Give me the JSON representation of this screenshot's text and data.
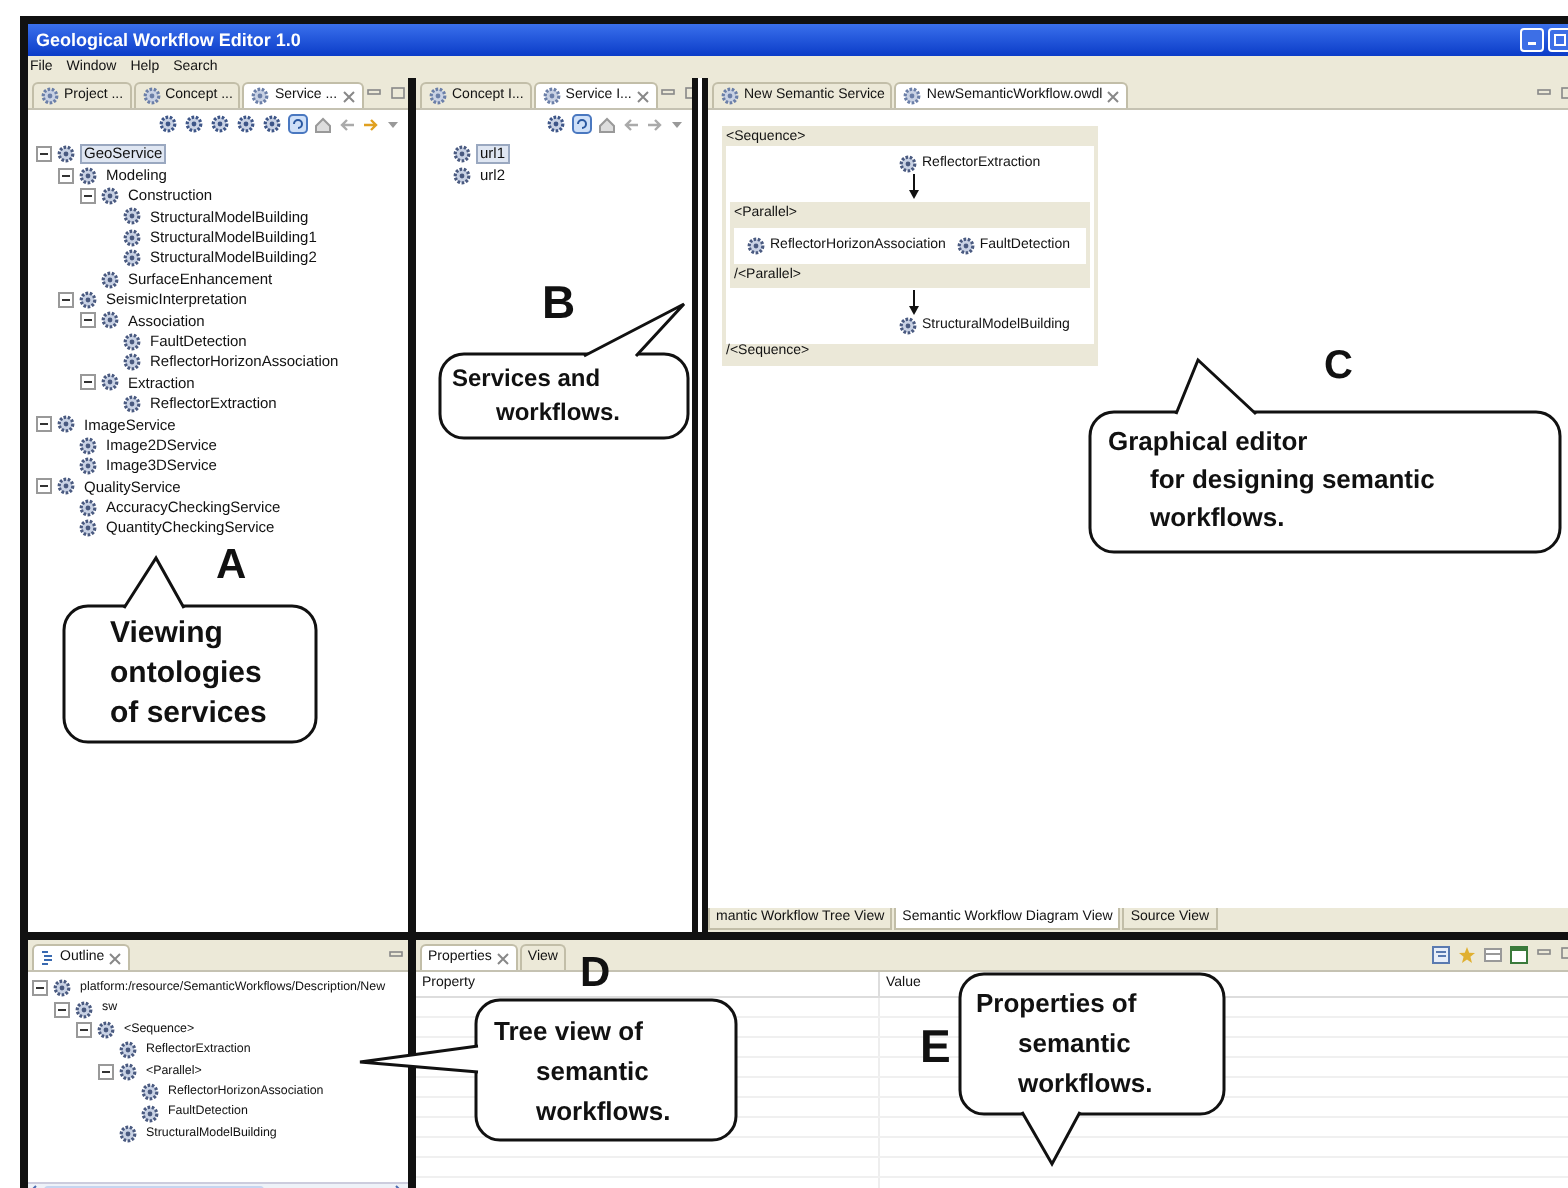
{
  "window": {
    "title": "Geological Workflow Editor 1.0"
  },
  "menu": [
    "File",
    "Window",
    "Help",
    "Search"
  ],
  "service_panel": {
    "tabs": [
      {
        "label": "Project ...",
        "selected": false
      },
      {
        "label": "Concept ...",
        "selected": false
      },
      {
        "label": "Service ...",
        "selected": true
      }
    ],
    "tree": [
      {
        "label": "GeoService",
        "selected": true,
        "expanded": true,
        "children": [
          {
            "label": "Modeling",
            "selected": false,
            "expanded": true,
            "children": [
              {
                "label": "Construction",
                "selected": false,
                "expanded": true,
                "children": [
                  {
                    "label": "StructuralModelBuilding",
                    "selected": false
                  },
                  {
                    "label": "StructuralModelBuilding1",
                    "selected": false
                  },
                  {
                    "label": "StructuralModelBuilding2",
                    "selected": false
                  }
                ]
              },
              {
                "label": "SurfaceEnhancement",
                "selected": false
              }
            ]
          },
          {
            "label": "SeismicInterpretation",
            "selected": false,
            "expanded": true,
            "children": [
              {
                "label": "Association",
                "selected": false,
                "expanded": true,
                "children": [
                  {
                    "label": "FaultDetection",
                    "selected": false
                  },
                  {
                    "label": "ReflectorHorizonAssociation",
                    "selected": false
                  }
                ]
              },
              {
                "label": "Extraction",
                "selected": false,
                "expanded": true,
                "children": [
                  {
                    "label": "ReflectorExtraction",
                    "selected": false
                  }
                ]
              }
            ]
          }
        ]
      },
      {
        "label": "ImageService",
        "selected": false,
        "expanded": true,
        "children": [
          {
            "label": "Image2DService",
            "selected": false
          },
          {
            "label": "Image3DService",
            "selected": false
          }
        ]
      },
      {
        "label": "QualityService",
        "selected": false,
        "expanded": true,
        "children": [
          {
            "label": "AccuracyCheckingService",
            "selected": false
          },
          {
            "label": "QuantityCheckingService",
            "selected": false
          }
        ]
      }
    ]
  },
  "services_panel": {
    "tabs": [
      {
        "label": "Concept I...",
        "selected": false
      },
      {
        "label": "Service I...",
        "selected": true
      }
    ],
    "tree": [
      {
        "label": "url1",
        "selected": true
      },
      {
        "label": "url2",
        "selected": false
      }
    ]
  },
  "editor": {
    "tabs": [
      {
        "label": "New Semantic Service",
        "selected": false
      },
      {
        "label": "NewSemanticWorkflow.owdl",
        "selected": true
      }
    ],
    "diagram": {
      "open": "<Sequence>",
      "close": "/<Sequence>",
      "steps": [
        {
          "kind": "service",
          "label": "ReflectorExtraction"
        },
        {
          "kind": "parallel",
          "open": "<Parallel>",
          "close": "/<Parallel>",
          "branches": [
            {
              "label": "ReflectorHorizonAssociation"
            },
            {
              "label": "FaultDetection"
            }
          ]
        },
        {
          "kind": "service",
          "label": "StructuralModelBuilding"
        }
      ]
    },
    "view_tabs": [
      {
        "label": "mantic Workflow Tree View",
        "selected": false
      },
      {
        "label": "Semantic Workflow Diagram View",
        "selected": true
      },
      {
        "label": "Source View",
        "selected": false
      }
    ]
  },
  "outline": {
    "tab": "Outline",
    "tree": [
      {
        "label": "platform:/resource/SemanticWorkflows/Description/New",
        "selected": false,
        "expanded": true,
        "children": [
          {
            "label": "sw",
            "selected": false,
            "expanded": true,
            "children": [
              {
                "label": "<Sequence>",
                "selected": false,
                "expanded": true,
                "children": [
                  {
                    "label": "ReflectorExtraction",
                    "selected": false
                  },
                  {
                    "label": "<Parallel>",
                    "selected": false,
                    "expanded": true,
                    "children": [
                      {
                        "label": "ReflectorHorizonAssociation",
                        "selected": false
                      },
                      {
                        "label": "FaultDetection",
                        "selected": false
                      }
                    ]
                  },
                  {
                    "label": "StructuralModelBuilding",
                    "selected": false
                  }
                ]
              }
            ]
          }
        ]
      }
    ]
  },
  "properties": {
    "tabs": [
      {
        "label": "Properties",
        "selected": true
      },
      {
        "label": "View",
        "selected": false
      }
    ],
    "columns": [
      "Property",
      "Value"
    ]
  },
  "callouts": [
    {
      "letter": "A",
      "lines": [
        "Viewing",
        "ontologies",
        "of services"
      ]
    },
    {
      "letter": "B",
      "lines": [
        "Services and",
        "workflows."
      ]
    },
    {
      "letter": "C",
      "lines": [
        "Graphical editor",
        "for designing semantic",
        "workflows."
      ]
    },
    {
      "letter": "D",
      "lines": [
        "Tree view of",
        "semantic",
        "workflows."
      ]
    },
    {
      "letter": "E",
      "lines": [
        "Properties of",
        "semantic",
        "workflows."
      ]
    }
  ]
}
